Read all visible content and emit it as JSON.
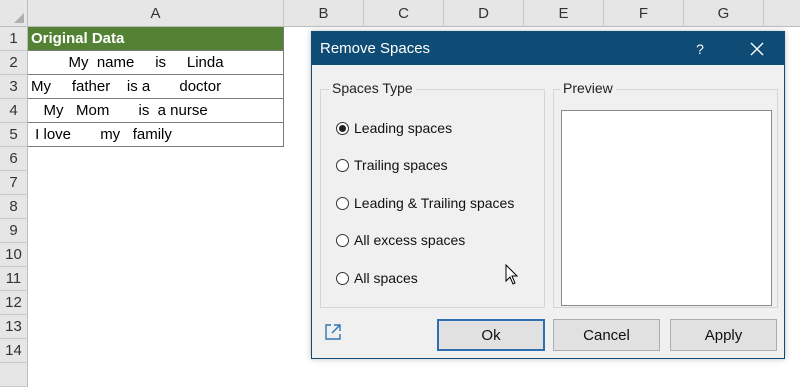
{
  "sheet": {
    "columns": [
      "A",
      "B",
      "C",
      "D",
      "E",
      "F",
      "G"
    ],
    "rows": [
      "1",
      "2",
      "3",
      "4",
      "5",
      "6",
      "7",
      "8",
      "9",
      "10",
      "11",
      "12",
      "13",
      "14"
    ],
    "cells": [
      "Original Data",
      "         My  name     is     Linda",
      "My     father    is a       doctor",
      "   My   Mom       is  a nurse",
      " I love       my   family"
    ]
  },
  "dialog": {
    "title": "Remove Spaces",
    "help": "?",
    "spaces_type_label": "Spaces Type",
    "options": [
      {
        "label": "Leading spaces",
        "selected": true
      },
      {
        "label": "Trailing spaces",
        "selected": false
      },
      {
        "label": "Leading & Trailing spaces",
        "selected": false
      },
      {
        "label": "All excess spaces",
        "selected": false
      },
      {
        "label": "All spaces",
        "selected": false
      }
    ],
    "preview_label": "Preview",
    "buttons": {
      "ok": "Ok",
      "cancel": "Cancel",
      "apply": "Apply"
    }
  },
  "colors": {
    "header_green": "#548235",
    "titlebar": "#0f4c75"
  }
}
